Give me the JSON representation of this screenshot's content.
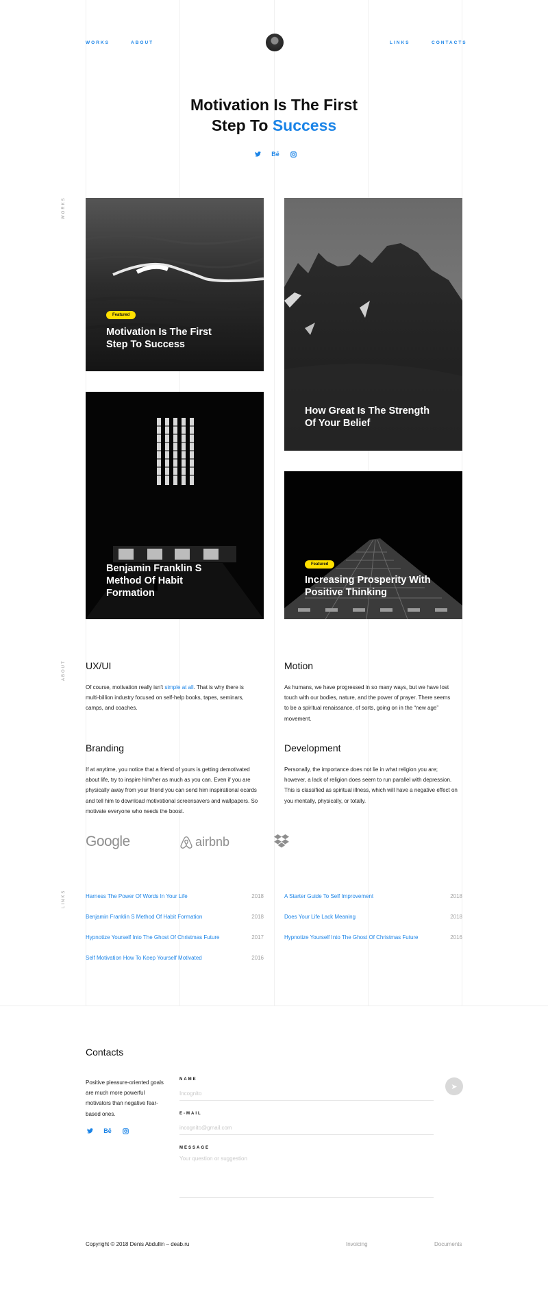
{
  "nav": {
    "works": "WORKS",
    "about": "ABOUT",
    "links": "LINKS",
    "contacts": "CONTACTS"
  },
  "hero": {
    "title_line1": "Motivation Is The First",
    "title_line2_pre": "Step To ",
    "title_line2_accent": "Success"
  },
  "social_icons": [
    "twitter-icon",
    "behance-icon",
    "instagram-icon"
  ],
  "social_text": {
    "behance": "Bē"
  },
  "side_labels": {
    "works": "WORKS",
    "about": "ABOUT",
    "links": "LINKS"
  },
  "cards": [
    {
      "badge": "Featured",
      "title": "Motivation Is The First Step To Success"
    },
    {
      "badge": "",
      "title": "How Great Is The Strength Of Your Belief"
    },
    {
      "badge": "",
      "title": "Benjamin Franklin S Method Of Habit Formation"
    },
    {
      "badge": "Featured",
      "title": "Increasing Prosperity With Positive Thinking"
    }
  ],
  "about": {
    "uxui": {
      "title": "UX/UI",
      "text_pre": "Of course, motivation really isn't ",
      "text_link": "simple at all",
      "text_post": ". That is why there is multi-billion industry focused on self-help books, tapes, seminars, camps, and coaches."
    },
    "motion": {
      "title": "Motion",
      "text": "As humans, we have progressed in so many ways, but we have lost touch with our bodies, nature, and the power of prayer. There seems to be a spiritual renaissance, of sorts, going on in the “new age” movement."
    },
    "branding": {
      "title": "Branding",
      "text": "If at anytime, you notice that a friend of yours is getting demotivated about life, try to inspire him/her as much as you can. Even if you are physically away from your friend you can send him inspirational ecards and tell him to download motivational screensavers and wallpapers. So motivate everyone who needs the boost."
    },
    "development": {
      "title": "Development",
      "text": "Personally, the importance does not lie in what religion you are; however, a lack of religion does seem to run parallel with depression. This is classified as spiritual illness, which will have a negative effect on you mentally, physically, or totally."
    }
  },
  "logos": {
    "google": "Google",
    "airbnb": "airbnb"
  },
  "links_left": [
    {
      "title": "Harness The Power Of Words In Your Life",
      "year": "2018"
    },
    {
      "title": "Benjamin Franklin S Method Of Habit Formation",
      "year": "2018"
    },
    {
      "title": "Hypnotize Yourself Into The Ghost Of Christmas Future",
      "year": "2017"
    },
    {
      "title": "Self Motivation How To Keep Yourself Motivated",
      "year": "2016"
    }
  ],
  "links_right": [
    {
      "title": "A Starter Guide To Self Improvement",
      "year": "2018"
    },
    {
      "title": "Does Your Life Lack Meaning",
      "year": "2018"
    },
    {
      "title": "Hypnotize Yourself Into The Ghost Of Christmas Future",
      "year": "2016"
    }
  ],
  "contacts": {
    "title": "Contacts",
    "text": "Positive pleasure-oriented goals are much more powerful motivators than negative fear-based ones.",
    "name_label": "NAME",
    "name_placeholder": "Incognito",
    "email_label": "E-MAIL",
    "email_placeholder": "incognito@gmail.com",
    "message_label": "MESSAGE",
    "message_placeholder": "Your question or suggestion",
    "send_symbol": "➤"
  },
  "footer": {
    "copyright": "Copyright © 2018 Denis Abdullin – deab.ru",
    "invoicing": "Invoicing",
    "documents": "Documents"
  },
  "colors": {
    "accent": "#1b84e7",
    "badge": "#ffe000"
  }
}
